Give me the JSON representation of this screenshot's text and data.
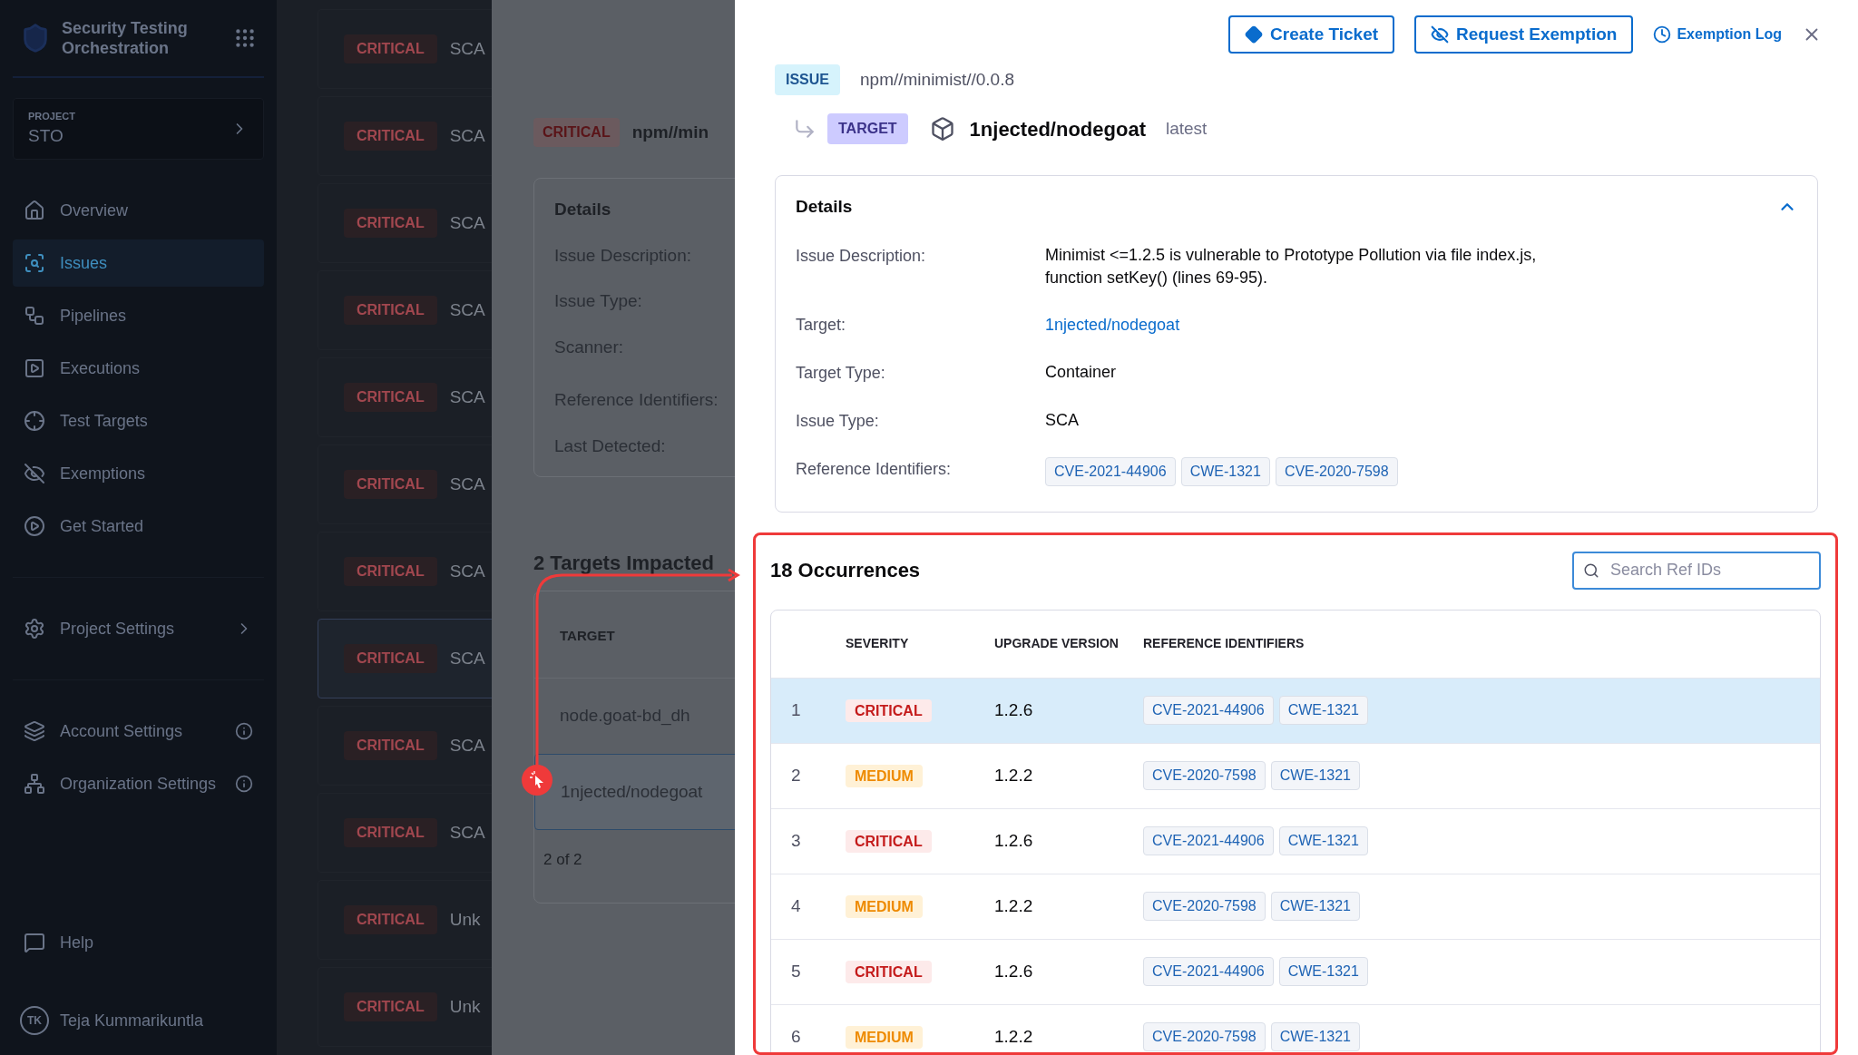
{
  "sidebar": {
    "title": "Security Testing Orchestration",
    "project_label": "PROJECT",
    "project": "STO",
    "items": [
      {
        "label": "Overview",
        "selected": false
      },
      {
        "label": "Issues",
        "selected": true
      },
      {
        "label": "Pipelines",
        "selected": false
      },
      {
        "label": "Executions",
        "selected": false
      },
      {
        "label": "Test Targets",
        "selected": false
      },
      {
        "label": "Exemptions",
        "selected": false
      },
      {
        "label": "Get Started",
        "selected": false
      }
    ],
    "project_settings": "Project Settings",
    "account_items": [
      {
        "label": "Account Settings"
      },
      {
        "label": "Organization Settings"
      }
    ],
    "help": "Help",
    "user": {
      "initials": "TK",
      "name": "Teja Kummarikuntla"
    }
  },
  "issue_list": [
    {
      "severity": "CRITICAL",
      "type": "SCA",
      "selected": false
    },
    {
      "severity": "CRITICAL",
      "type": "SCA",
      "selected": false
    },
    {
      "severity": "CRITICAL",
      "type": "SCA",
      "selected": false
    },
    {
      "severity": "CRITICAL",
      "type": "SCA",
      "selected": false
    },
    {
      "severity": "CRITICAL",
      "type": "SCA",
      "selected": false
    },
    {
      "severity": "CRITICAL",
      "type": "SCA",
      "selected": false
    },
    {
      "severity": "CRITICAL",
      "type": "SCA",
      "selected": false
    },
    {
      "severity": "CRITICAL",
      "type": "SCA",
      "selected": true
    },
    {
      "severity": "CRITICAL",
      "type": "SCA",
      "selected": false
    },
    {
      "severity": "CRITICAL",
      "type": "SCA",
      "selected": false
    },
    {
      "severity": "CRITICAL",
      "type": "Unk",
      "selected": false
    },
    {
      "severity": "CRITICAL",
      "type": "Unk",
      "selected": false
    }
  ],
  "issue_panel": {
    "severity": "CRITICAL",
    "title": "npm//min",
    "details_title": "Details",
    "labels": [
      "Issue Description:",
      "Issue Type:",
      "Scanner:",
      "Reference Identifiers:",
      "Last Detected:"
    ],
    "targets_title": "2 Targets Impacted",
    "column": "TARGET",
    "targets": [
      {
        "name": "node.goat-bd_dh",
        "selected": false
      },
      {
        "name": "1njected/nodegoat",
        "selected": true
      }
    ],
    "pagination": "2 of 2"
  },
  "drawer": {
    "buttons": [
      {
        "label": "Create Ticket"
      },
      {
        "label": "Request Exemption"
      }
    ],
    "exemption_log": "Exemption Log",
    "issue_badge": "ISSUE",
    "issue": "npm//minimist//0.0.8",
    "target_badge": "TARGET",
    "target": "1njected/nodegoat",
    "target_tag": "latest",
    "details": {
      "title": "Details",
      "expanded": true,
      "fields": [
        {
          "label": "Issue Description:",
          "kind": "text",
          "value": "Minimist <=1.2.5 is vulnerable to Prototype Pollution via file index.js, function setKey() (lines 69-95)."
        },
        {
          "label": "Target:",
          "kind": "link",
          "value": "1njected/nodegoat"
        },
        {
          "label": "Target Type:",
          "kind": "text",
          "value": "Container"
        },
        {
          "label": "Issue Type:",
          "kind": "text",
          "value": "SCA"
        },
        {
          "label": "Reference Identifiers:",
          "kind": "tags",
          "tags": [
            "CVE-2021-44906",
            "CWE-1321",
            "CVE-2020-7598"
          ]
        }
      ]
    },
    "occurrences": {
      "title": "18 Occurrences",
      "search": {
        "placeholder": "Search Ref IDs"
      },
      "columns": [
        "SEVERITY",
        "UPGRADE VERSION",
        "REFERENCE IDENTIFIERS"
      ],
      "rows": [
        {
          "index": "1",
          "severity": "CRITICAL",
          "kind": "critical",
          "upgrade": "1.2.6",
          "refs": [
            "CVE-2021-44906",
            "CWE-1321"
          ],
          "selected": true
        },
        {
          "index": "2",
          "severity": "MEDIUM",
          "kind": "medium",
          "upgrade": "1.2.2",
          "refs": [
            "CVE-2020-7598",
            "CWE-1321"
          ],
          "selected": false
        },
        {
          "index": "3",
          "severity": "CRITICAL",
          "kind": "critical",
          "upgrade": "1.2.6",
          "refs": [
            "CVE-2021-44906",
            "CWE-1321"
          ],
          "selected": false
        },
        {
          "index": "4",
          "severity": "MEDIUM",
          "kind": "medium",
          "upgrade": "1.2.2",
          "refs": [
            "CVE-2020-7598",
            "CWE-1321"
          ],
          "selected": false
        },
        {
          "index": "5",
          "severity": "CRITICAL",
          "kind": "critical",
          "upgrade": "1.2.6",
          "refs": [
            "CVE-2021-44906",
            "CWE-1321"
          ],
          "selected": false
        },
        {
          "index": "6",
          "severity": "MEDIUM",
          "kind": "medium",
          "upgrade": "1.2.2",
          "refs": [
            "CVE-2020-7598",
            "CWE-1321"
          ],
          "selected": false
        }
      ]
    }
  }
}
